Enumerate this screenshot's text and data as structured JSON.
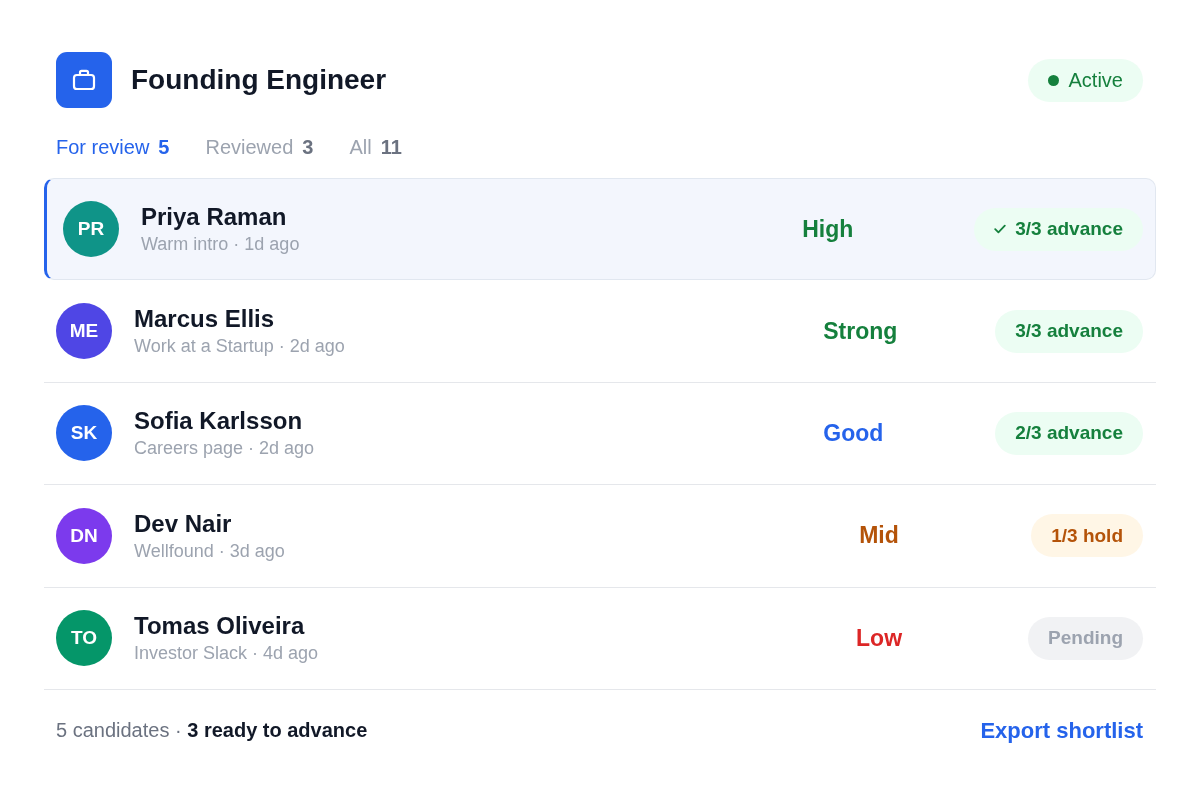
{
  "header": {
    "title": "Founding Engineer",
    "status": {
      "label": "Active",
      "kind": "active"
    }
  },
  "tabs": [
    {
      "label": "For review",
      "count": "5",
      "selected": true
    },
    {
      "label": "Reviewed",
      "count": "3",
      "selected": false
    },
    {
      "label": "All",
      "count": "11",
      "selected": false
    }
  ],
  "candidates": [
    {
      "avatar": {
        "initials": "PR",
        "color": "#0f9488"
      },
      "name": "Priya Raman",
      "source": "Warm intro · 1d ago",
      "selected": true,
      "score": {
        "label": "High",
        "color": "#15803d"
      },
      "verdict": {
        "label": "3/3 advance",
        "kind": "advance",
        "confirmed": true
      }
    },
    {
      "avatar": {
        "initials": "ME",
        "color": "#4f46e5"
      },
      "name": "Marcus Ellis",
      "source": "Work at a Startup · 2d ago",
      "selected": false,
      "score": {
        "label": "Strong",
        "color": "#15803d"
      },
      "verdict": {
        "label": "3/3 advance",
        "kind": "advance",
        "confirmed": false
      }
    },
    {
      "avatar": {
        "initials": "SK",
        "color": "#2563eb"
      },
      "name": "Sofia Karlsson",
      "source": "Careers page · 2d ago",
      "selected": false,
      "score": {
        "label": "Good",
        "color": "#2563eb"
      },
      "verdict": {
        "label": "2/3 advance",
        "kind": "advance",
        "confirmed": false
      }
    },
    {
      "avatar": {
        "initials": "DN",
        "color": "#7c3aed"
      },
      "name": "Dev Nair",
      "source": "Wellfound · 3d ago",
      "selected": false,
      "score": {
        "label": "Mid",
        "color": "#b45309"
      },
      "verdict": {
        "label": "1/3 hold",
        "kind": "hold",
        "confirmed": false
      }
    },
    {
      "avatar": {
        "initials": "TO",
        "color": "#059669"
      },
      "name": "Tomas Oliveira",
      "source": "Investor Slack · 4d ago",
      "selected": false,
      "score": {
        "label": "Low",
        "color": "#dc2626"
      },
      "verdict": {
        "label": "Pending",
        "kind": "pending",
        "confirmed": false
      }
    }
  ],
  "footer": {
    "summary": "5 candidates · **3 ready to advance**",
    "action": "Export shortlist"
  }
}
